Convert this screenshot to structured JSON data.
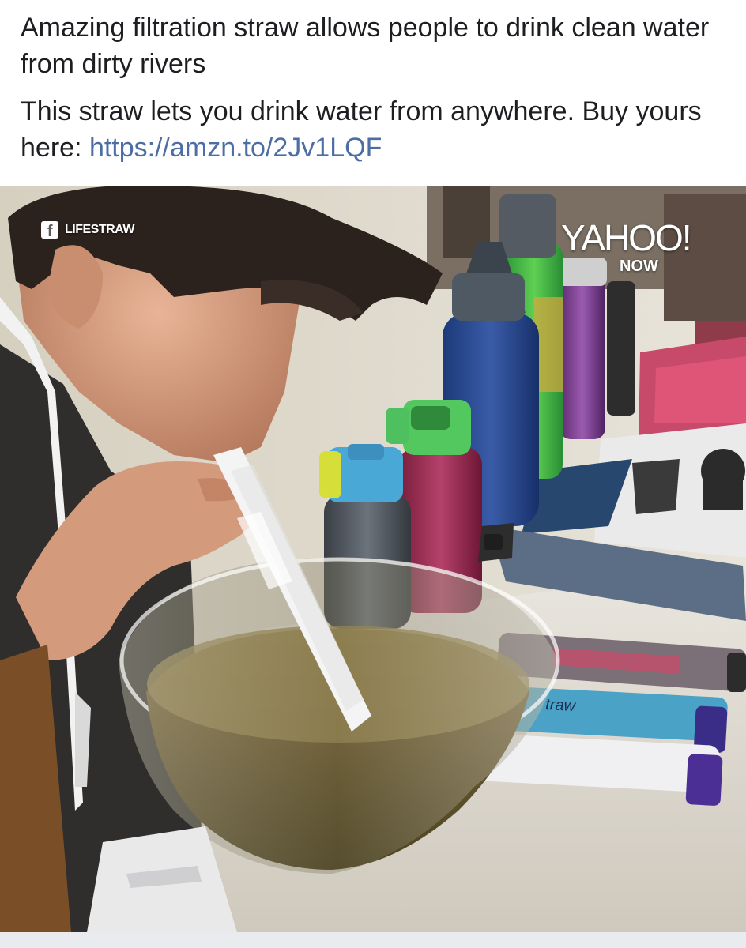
{
  "post": {
    "headline": "Amazing filtration straw allows people to drink clean water from dirty rivers",
    "body_text": "This straw lets you drink water from anywhere. Buy yours here: ",
    "link_text": "https://amzn.to/2Jv1LQF"
  },
  "video": {
    "source_badge_icon": "facebook-icon",
    "source_badge_glyph": "f",
    "source_badge_label": "LIFESTRAW",
    "brand_logo": "YAHOO!",
    "brand_sublabel": "NOW",
    "printed_item_labels": {
      "straw_label": "traw"
    }
  },
  "colors": {
    "link": "#4c6ea5",
    "text": "#1c1e21",
    "footer": "#e9ebee"
  }
}
